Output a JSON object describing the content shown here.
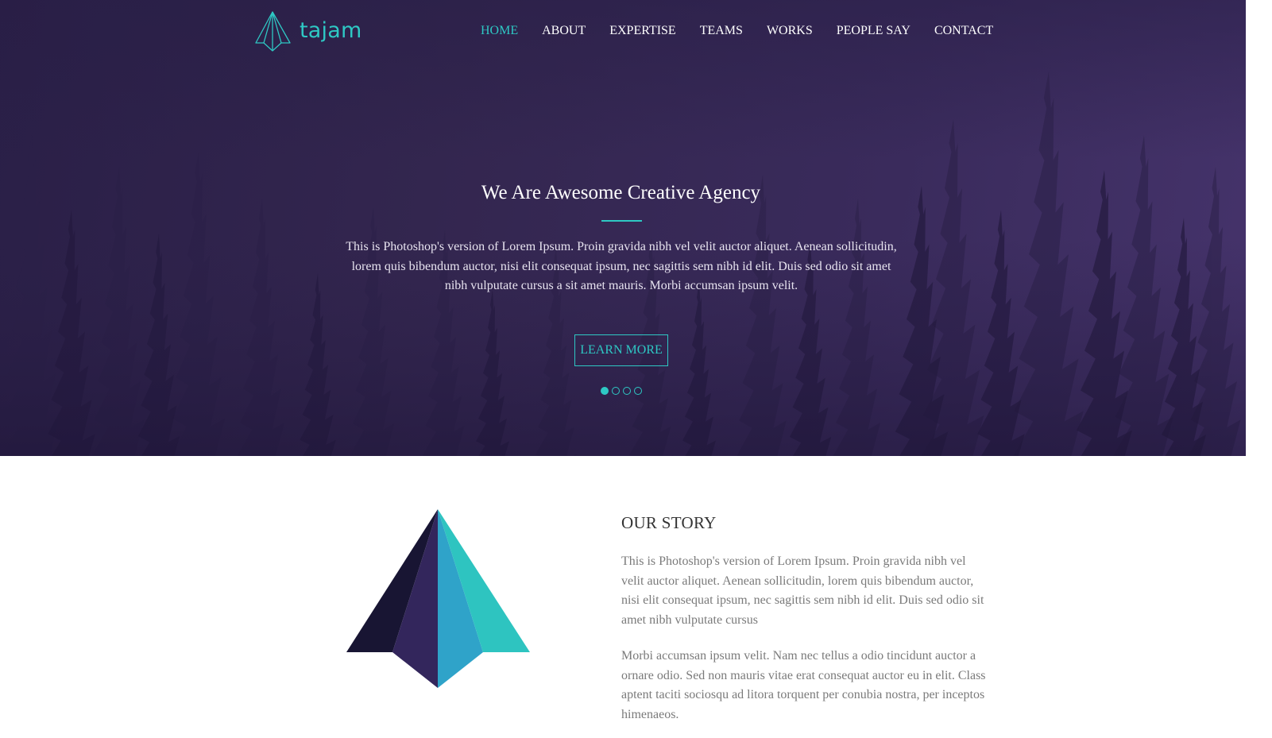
{
  "brand": {
    "name": "tajam",
    "accent_color": "#2ec8c4"
  },
  "nav": {
    "items": [
      {
        "label": "HOME",
        "active": true
      },
      {
        "label": "ABOUT",
        "active": false
      },
      {
        "label": "EXPERTISE",
        "active": false
      },
      {
        "label": "TEAMS",
        "active": false
      },
      {
        "label": "WORKS",
        "active": false
      },
      {
        "label": "PEOPLE SAY",
        "active": false
      },
      {
        "label": "CONTACT",
        "active": false
      }
    ]
  },
  "hero": {
    "title": "We Are Awesome Creative Agency",
    "text": "This is Photoshop's version of Lorem Ipsum. Proin gravida nibh vel velit auctor aliquet. Aenean sollicitudin, lorem quis bibendum auctor, nisi elit consequat ipsum, nec sagittis sem nibh id elit. Duis sed odio sit amet nibh vulputate cursus a sit amet mauris. Morbi accumsan ipsum velit.",
    "button_label": "LEARN MORE",
    "slides_count": 4,
    "active_slide": 1,
    "background_color": "#33264f"
  },
  "story": {
    "title": "OUR STORY",
    "paragraph1": "This is Photoshop's version of Lorem Ipsum. Proin gravida nibh vel velit auctor aliquet. Aenean sollicitudin, lorem quis bibendum auctor, nisi elit consequat ipsum, nec sagittis sem nibh id elit. Duis sed odio sit amet nibh vulputate cursus",
    "paragraph2": "Morbi accumsan ipsum velit. Nam nec tellus a odio tincidunt auctor a ornare odio. Sed non mauris vitae erat consequat auctor eu in elit. Class aptent taciti sociosqu ad litora torquent per conubia nostra, per inceptos himenaeos.",
    "graphic_icon": "paper-plane-icon",
    "graphic_colors": [
      "#181533",
      "#33265c",
      "#2fa3c9",
      "#2ec4c0"
    ]
  }
}
